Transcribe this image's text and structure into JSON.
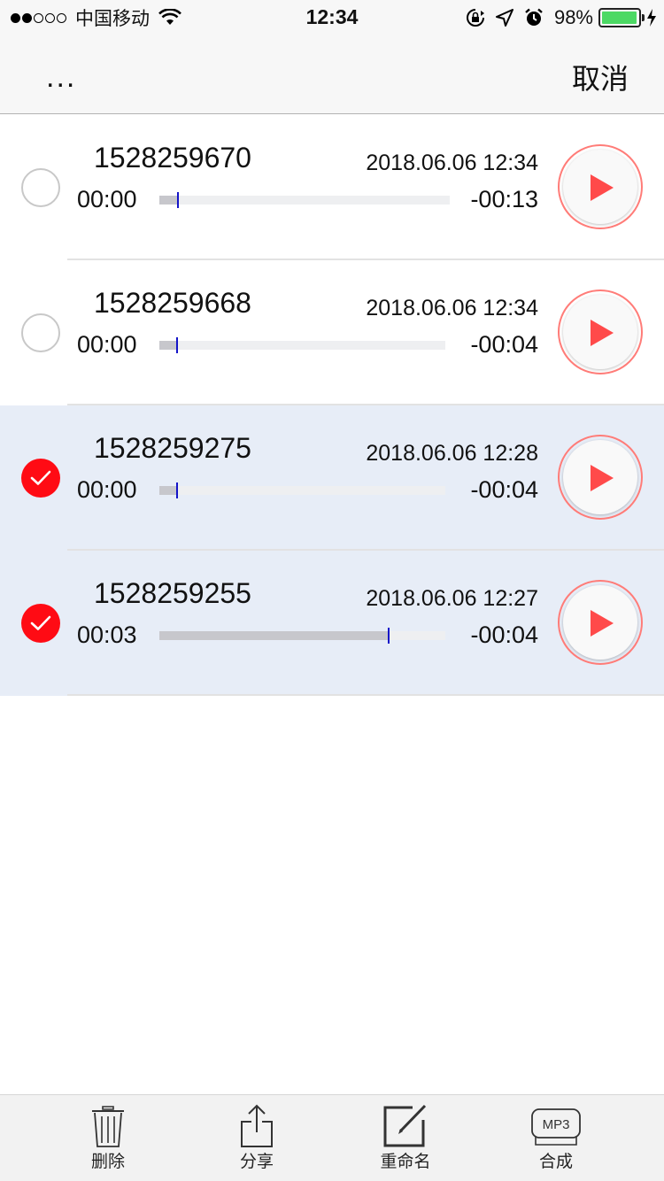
{
  "status_bar": {
    "carrier": "中国移动",
    "time": "12:34",
    "battery": "98%",
    "battery_level": 0.98,
    "signal_bars": 2,
    "icons": [
      "wifi-icon",
      "rotation-lock-icon",
      "location-icon",
      "alarm-icon",
      "charging-icon"
    ]
  },
  "nav": {
    "more_label": "...",
    "cancel_label": "取消"
  },
  "recordings": [
    {
      "name": "1528259670",
      "date": "2018.06.06 12:34",
      "elapsed": "00:00",
      "remaining": "-00:13",
      "progress": 0.06,
      "selected": false
    },
    {
      "name": "1528259668",
      "date": "2018.06.06 12:34",
      "elapsed": "00:00",
      "remaining": "-00:04",
      "progress": 0.06,
      "selected": false
    },
    {
      "name": "1528259275",
      "date": "2018.06.06 12:28",
      "elapsed": "00:00",
      "remaining": "-00:04",
      "progress": 0.06,
      "selected": true
    },
    {
      "name": "1528259255",
      "date": "2018.06.06 12:27",
      "elapsed": "00:03",
      "remaining": "-00:04",
      "progress": 0.8,
      "selected": true
    }
  ],
  "toolbar": {
    "delete_label": "删除",
    "share_label": "分享",
    "rename_label": "重命名",
    "merge_label": "合成",
    "merge_icon_text": "MP3"
  },
  "colors": {
    "accent_red": "#ff0b14",
    "play_triangle": "#ff4a4a",
    "selected_row": "#e7edf7",
    "progress_knob": "#1414c8",
    "battery_green": "#4cd964"
  }
}
